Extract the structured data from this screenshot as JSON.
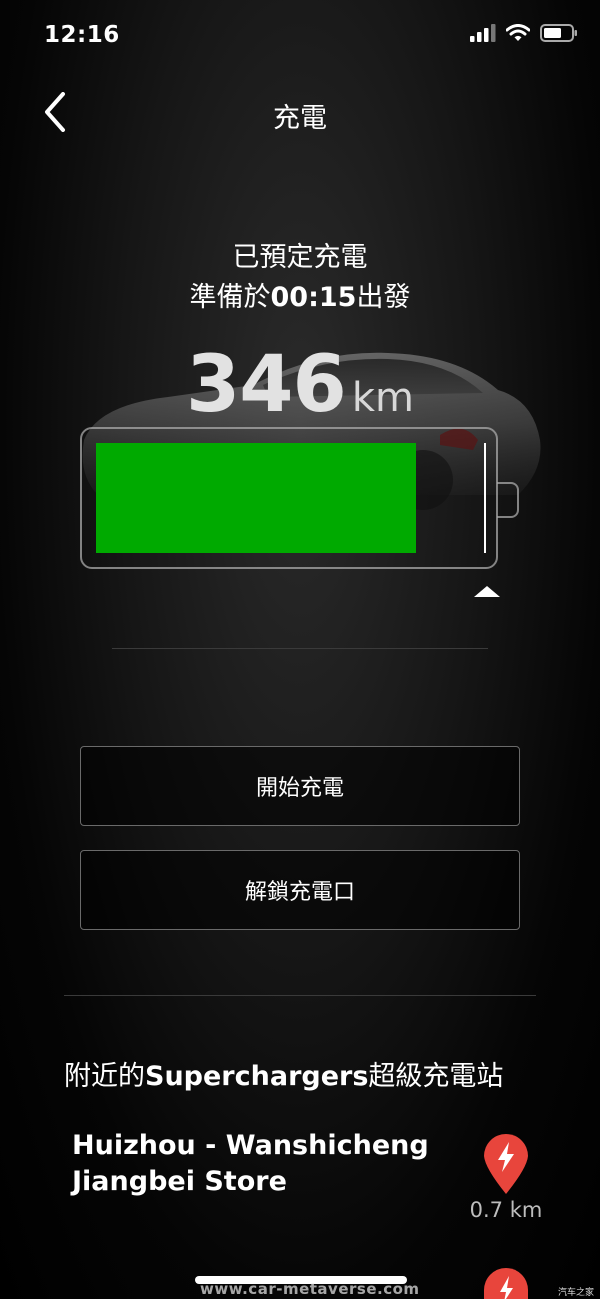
{
  "status_bar": {
    "time": "12:16",
    "icons": [
      "signal-icon",
      "wifi-icon",
      "battery-icon"
    ]
  },
  "header": {
    "back_icon": "chevron-left-icon",
    "title": "充電"
  },
  "charge_status": {
    "line1": "已預定充電",
    "departure_prefix": "準備於",
    "departure_time": "00:15",
    "departure_suffix": "出發"
  },
  "range": {
    "value": "346",
    "unit": "km"
  },
  "battery": {
    "level_fraction": 0.82,
    "charge_limit_fraction": 1.0,
    "fill_color": "#00aa00"
  },
  "actions": {
    "start_charging": "開始充電",
    "unlock_port": "解鎖充電口"
  },
  "superchargers": {
    "title_prefix": "附近的",
    "title_bold": "Superchargers",
    "title_suffix": "超級充電站",
    "stations": [
      {
        "name_line1": "Huizhou - Wanshicheng",
        "name_line2": "Jiangbei Store",
        "distance": "0.7 km",
        "icon": "supercharger-pin-icon",
        "pin_color": "#e8453c"
      }
    ]
  },
  "watermark": "www.car-metaverse.com",
  "logo_text": "汽车之家"
}
